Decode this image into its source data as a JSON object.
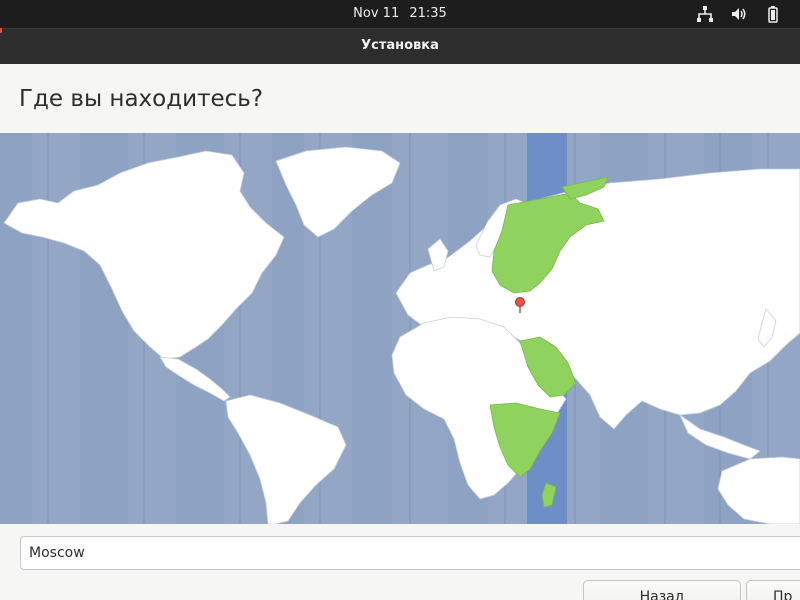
{
  "topbar": {
    "date": "Nov 11",
    "time": "21:35",
    "icons": [
      "network-icon",
      "volume-icon",
      "battery-icon"
    ]
  },
  "window": {
    "title": "Установка"
  },
  "page": {
    "heading": "Где вы находитесь?"
  },
  "map": {
    "ocean_color": "#93a6c6",
    "land_color": "#ffffff",
    "highlight_color": "#8fd25e",
    "selected_band_color": "#6e8ec8",
    "marker_color": "#e8524a",
    "selected_city": "Moscow"
  },
  "timezone": {
    "value": "Moscow"
  },
  "buttons": {
    "back": "Назад",
    "next": "Пр"
  }
}
